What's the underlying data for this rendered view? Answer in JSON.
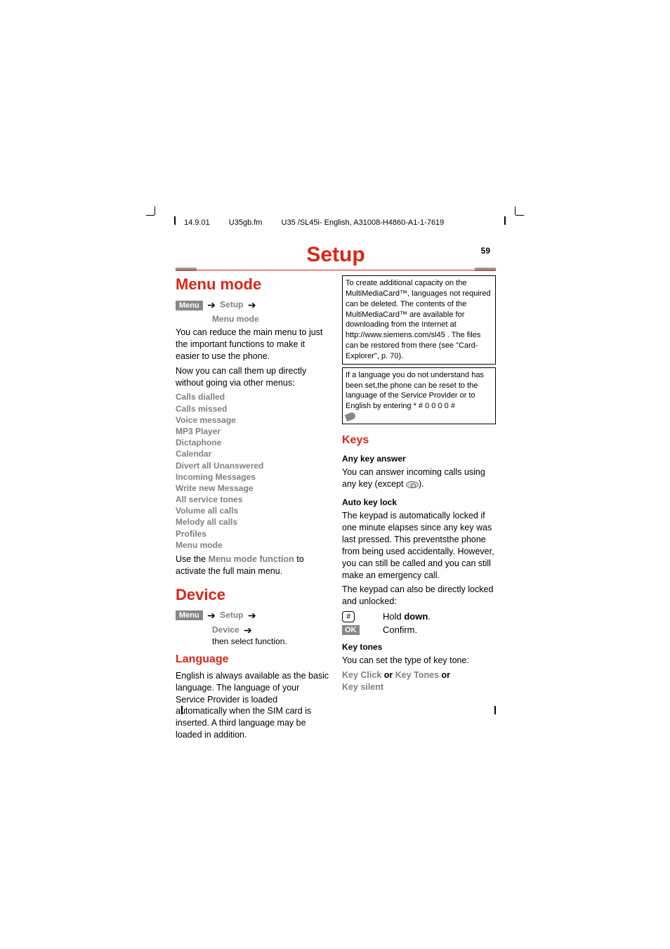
{
  "header": {
    "date": "14.9.01",
    "file": "U35gb.fm",
    "doc": "U35 /SL45i- English, A31008-H4860-A1-1-7619"
  },
  "page": {
    "title": "Setup",
    "number": "59"
  },
  "left": {
    "h_menu_mode": "Menu mode",
    "menu_btn": "Menu",
    "path_setup": "Setup",
    "path_menu_mode": "Menu mode",
    "intro1": "You can reduce the main menu to just the important functions to make it easier to use the phone.",
    "intro2": "Now you can call them up directly without going via other menus:",
    "items": [
      "Calls dialled",
      "Calls missed",
      "Voice message",
      "MP3 Player",
      "Dictaphone",
      "Calendar",
      "Divert all Unanswered",
      "Incoming Messages",
      "Write new Message",
      "All service tones",
      "Volume all calls",
      "Melody all calls",
      "Profiles",
      "Menu mode"
    ],
    "use_pre": "Use the ",
    "use_bold": "Menu mode function",
    "use_post": " to activate the full main menu.",
    "h_device": "Device",
    "path_device": "Device",
    "then_select": "then select function.",
    "h_language": "Language",
    "language_para": "English is always available as the basic language. The language of your Service Provider is loaded automatically when the SIM card is inserted. A third language may be loaded in addition."
  },
  "right": {
    "box1": "To create additional capacity on the MultiMediaCard™, languages not required can be deleted. The contents of the MultiMediaCard™ are available for downloading from the Internet at http://www.siemens.com/sl45 . The files can be restored from there (see \"Card-Explorer\", p. 70).",
    "box2_pre": "If a language you do not understand has been set,the phone can be reset to the language of the Service Provider or to English by entering ",
    "box2_code": "* # 0 0 0 0 #",
    "h_keys": "Keys",
    "h_any_key": "Any key answer",
    "any_key_pre": "You can answer incoming calls using any key (except ",
    "any_key_post": ").",
    "h_auto_lock": "Auto key lock",
    "auto_lock_para": "The keypad is automatically locked if one minute elapses since any key was last pressed. This preventsthe phone from being used accidentally. However, you can still be called and you can still make an emergency call.",
    "lock_unlock": "The keypad can also be directly locked and unlocked:",
    "hold_pre": "Hold ",
    "hold_bold": "down",
    "hold_post": ".",
    "ok_label": "OK",
    "confirm": "Confirm.",
    "h_key_tones": "Key tones",
    "set_tone": "You can set the type of key tone:",
    "kt_1": "Key Click",
    "kt_or": " or ",
    "kt_2": "Key Tones",
    "kt_3": "Key silent",
    "hash_key": "#"
  }
}
